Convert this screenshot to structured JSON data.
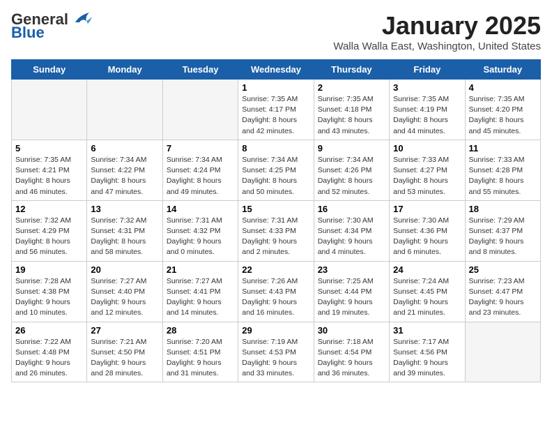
{
  "header": {
    "logo_general": "General",
    "logo_blue": "Blue",
    "month_title": "January 2025",
    "location": "Walla Walla East, Washington, United States"
  },
  "days_of_week": [
    "Sunday",
    "Monday",
    "Tuesday",
    "Wednesday",
    "Thursday",
    "Friday",
    "Saturday"
  ],
  "weeks": [
    [
      {
        "day": "",
        "info": ""
      },
      {
        "day": "",
        "info": ""
      },
      {
        "day": "",
        "info": ""
      },
      {
        "day": "1",
        "info": "Sunrise: 7:35 AM\nSunset: 4:17 PM\nDaylight: 8 hours and 42 minutes."
      },
      {
        "day": "2",
        "info": "Sunrise: 7:35 AM\nSunset: 4:18 PM\nDaylight: 8 hours and 43 minutes."
      },
      {
        "day": "3",
        "info": "Sunrise: 7:35 AM\nSunset: 4:19 PM\nDaylight: 8 hours and 44 minutes."
      },
      {
        "day": "4",
        "info": "Sunrise: 7:35 AM\nSunset: 4:20 PM\nDaylight: 8 hours and 45 minutes."
      }
    ],
    [
      {
        "day": "5",
        "info": "Sunrise: 7:35 AM\nSunset: 4:21 PM\nDaylight: 8 hours and 46 minutes."
      },
      {
        "day": "6",
        "info": "Sunrise: 7:34 AM\nSunset: 4:22 PM\nDaylight: 8 hours and 47 minutes."
      },
      {
        "day": "7",
        "info": "Sunrise: 7:34 AM\nSunset: 4:24 PM\nDaylight: 8 hours and 49 minutes."
      },
      {
        "day": "8",
        "info": "Sunrise: 7:34 AM\nSunset: 4:25 PM\nDaylight: 8 hours and 50 minutes."
      },
      {
        "day": "9",
        "info": "Sunrise: 7:34 AM\nSunset: 4:26 PM\nDaylight: 8 hours and 52 minutes."
      },
      {
        "day": "10",
        "info": "Sunrise: 7:33 AM\nSunset: 4:27 PM\nDaylight: 8 hours and 53 minutes."
      },
      {
        "day": "11",
        "info": "Sunrise: 7:33 AM\nSunset: 4:28 PM\nDaylight: 8 hours and 55 minutes."
      }
    ],
    [
      {
        "day": "12",
        "info": "Sunrise: 7:32 AM\nSunset: 4:29 PM\nDaylight: 8 hours and 56 minutes."
      },
      {
        "day": "13",
        "info": "Sunrise: 7:32 AM\nSunset: 4:31 PM\nDaylight: 8 hours and 58 minutes."
      },
      {
        "day": "14",
        "info": "Sunrise: 7:31 AM\nSunset: 4:32 PM\nDaylight: 9 hours and 0 minutes."
      },
      {
        "day": "15",
        "info": "Sunrise: 7:31 AM\nSunset: 4:33 PM\nDaylight: 9 hours and 2 minutes."
      },
      {
        "day": "16",
        "info": "Sunrise: 7:30 AM\nSunset: 4:34 PM\nDaylight: 9 hours and 4 minutes."
      },
      {
        "day": "17",
        "info": "Sunrise: 7:30 AM\nSunset: 4:36 PM\nDaylight: 9 hours and 6 minutes."
      },
      {
        "day": "18",
        "info": "Sunrise: 7:29 AM\nSunset: 4:37 PM\nDaylight: 9 hours and 8 minutes."
      }
    ],
    [
      {
        "day": "19",
        "info": "Sunrise: 7:28 AM\nSunset: 4:38 PM\nDaylight: 9 hours and 10 minutes."
      },
      {
        "day": "20",
        "info": "Sunrise: 7:27 AM\nSunset: 4:40 PM\nDaylight: 9 hours and 12 minutes."
      },
      {
        "day": "21",
        "info": "Sunrise: 7:27 AM\nSunset: 4:41 PM\nDaylight: 9 hours and 14 minutes."
      },
      {
        "day": "22",
        "info": "Sunrise: 7:26 AM\nSunset: 4:43 PM\nDaylight: 9 hours and 16 minutes."
      },
      {
        "day": "23",
        "info": "Sunrise: 7:25 AM\nSunset: 4:44 PM\nDaylight: 9 hours and 19 minutes."
      },
      {
        "day": "24",
        "info": "Sunrise: 7:24 AM\nSunset: 4:45 PM\nDaylight: 9 hours and 21 minutes."
      },
      {
        "day": "25",
        "info": "Sunrise: 7:23 AM\nSunset: 4:47 PM\nDaylight: 9 hours and 23 minutes."
      }
    ],
    [
      {
        "day": "26",
        "info": "Sunrise: 7:22 AM\nSunset: 4:48 PM\nDaylight: 9 hours and 26 minutes."
      },
      {
        "day": "27",
        "info": "Sunrise: 7:21 AM\nSunset: 4:50 PM\nDaylight: 9 hours and 28 minutes."
      },
      {
        "day": "28",
        "info": "Sunrise: 7:20 AM\nSunset: 4:51 PM\nDaylight: 9 hours and 31 minutes."
      },
      {
        "day": "29",
        "info": "Sunrise: 7:19 AM\nSunset: 4:53 PM\nDaylight: 9 hours and 33 minutes."
      },
      {
        "day": "30",
        "info": "Sunrise: 7:18 AM\nSunset: 4:54 PM\nDaylight: 9 hours and 36 minutes."
      },
      {
        "day": "31",
        "info": "Sunrise: 7:17 AM\nSunset: 4:56 PM\nDaylight: 9 hours and 39 minutes."
      },
      {
        "day": "",
        "info": ""
      }
    ]
  ]
}
